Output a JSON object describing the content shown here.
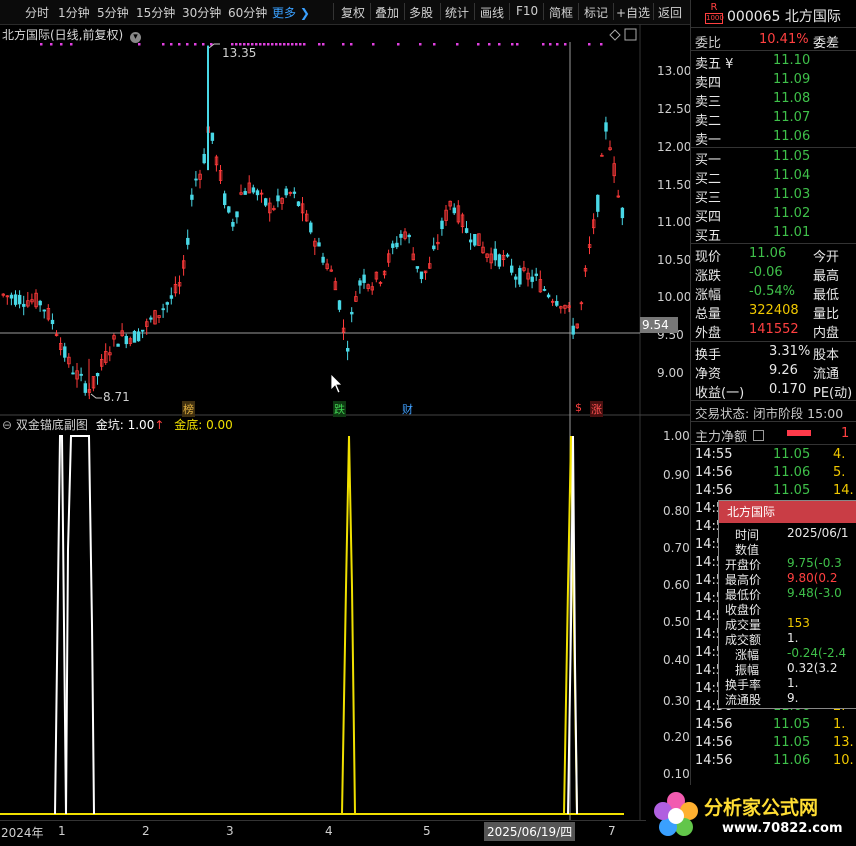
{
  "toolbar": {
    "items": [
      "分时",
      "1分钟",
      "5分钟",
      "15分钟",
      "30分钟",
      "60分钟",
      "更多 ❯",
      "复权",
      "叠加",
      "多股",
      "统计",
      "画线",
      "F10",
      "简框",
      "标记",
      "+自选",
      "返回"
    ]
  },
  "chart": {
    "title": "北方国际(日线,前复权)",
    "price_axis": [
      "13.00",
      "12.50",
      "12.00",
      "11.50",
      "11.00",
      "10.50",
      "10.00",
      "9.50",
      "9.00"
    ],
    "crosshair_price": "9.54",
    "high_label": "13.35",
    "low_label": "8.71",
    "markers": [
      "榜",
      "跌",
      "财",
      "$",
      "涨"
    ]
  },
  "indicator": {
    "name": "双金锚底副图",
    "jinkeng_label": "金坑:",
    "jinkeng_value": "1.00",
    "jindi_label": "金底:",
    "jindi_value": "0.00",
    "axis": [
      "1.00",
      "0.90",
      "0.80",
      "0.70",
      "0.60",
      "0.50",
      "0.40",
      "0.30",
      "0.20",
      "0.10"
    ]
  },
  "bottom_axis": {
    "labels": [
      "2024年",
      "1",
      "2",
      "3",
      "4",
      "5",
      "2025/06/19/四",
      "7"
    ]
  },
  "quote": {
    "code": "000065",
    "name": "北方国际",
    "badge_top": "R",
    "badge_bottom": "1000",
    "webi_label": "委比",
    "webi_value": "10.41%",
    "weicha_label": "委差",
    "asks": [
      {
        "label": "卖五 ¥",
        "price": "11.10"
      },
      {
        "label": "卖四",
        "price": "11.09"
      },
      {
        "label": "卖三",
        "price": "11.08"
      },
      {
        "label": "卖二",
        "price": "11.07"
      },
      {
        "label": "卖一",
        "price": "11.06"
      }
    ],
    "bids": [
      {
        "label": "买一",
        "price": "11.05"
      },
      {
        "label": "买二",
        "price": "11.04"
      },
      {
        "label": "买三",
        "price": "11.03"
      },
      {
        "label": "买四",
        "price": "11.02"
      },
      {
        "label": "买五",
        "price": "11.01"
      }
    ],
    "stats": [
      {
        "label": "现价",
        "value": "11.06",
        "label2": "今开"
      },
      {
        "label": "涨跌",
        "value": "-0.06",
        "label2": "最高"
      },
      {
        "label": "涨幅",
        "value": "-0.54%",
        "label2": "最低"
      },
      {
        "label": "总量",
        "value": "322408",
        "label2": "量比"
      },
      {
        "label": "外盘",
        "value": "141552",
        "label2": "内盘"
      }
    ],
    "stats2": [
      {
        "label": "换手",
        "value": "3.31%",
        "label2": "股本"
      },
      {
        "label": "净资",
        "value": "9.26",
        "label2": "流通"
      },
      {
        "label": "收益(一)",
        "value": "0.170",
        "label2": "PE(动)"
      }
    ],
    "status": "交易状态: 闭市阶段 15:00",
    "main_force_label": "主力净额",
    "main_force_value": "1"
  },
  "ticks": [
    {
      "time": "14:55",
      "price": "11.05",
      "vol": "4."
    },
    {
      "time": "14:56",
      "price": "11.06",
      "vol": "5."
    },
    {
      "time": "14:56",
      "price": "11.05",
      "vol": "14."
    },
    {
      "time": "14:5",
      "price": "",
      "vol": ""
    },
    {
      "time": "14:5",
      "price": "",
      "vol": ""
    },
    {
      "time": "14:5",
      "price": "",
      "vol": ""
    },
    {
      "time": "14:5",
      "price": "",
      "vol": ""
    },
    {
      "time": "14:5",
      "price": "",
      "vol": ""
    },
    {
      "time": "14:5",
      "price": "",
      "vol": ""
    },
    {
      "time": "14:5",
      "price": "",
      "vol": ""
    },
    {
      "time": "14:5",
      "price": "",
      "vol": ""
    },
    {
      "time": "14:5",
      "price": "",
      "vol": ""
    },
    {
      "time": "14:5",
      "price": "",
      "vol": ""
    },
    {
      "time": "14:5",
      "price": "",
      "vol": ""
    },
    {
      "time": "14:56",
      "price": "11.06",
      "vol": "2."
    },
    {
      "time": "14:56",
      "price": "11.05",
      "vol": "1."
    },
    {
      "time": "14:56",
      "price": "11.05",
      "vol": "13."
    },
    {
      "time": "14:56",
      "price": "11.06",
      "vol": "10."
    }
  ],
  "tooltip": {
    "title": "北方国际",
    "rows": [
      {
        "label": "时间",
        "value": "2025/06/1"
      },
      {
        "label": "数值",
        "value": ""
      },
      {
        "label": "开盘价",
        "value": "9.75(-0.3"
      },
      {
        "label": "最高价",
        "value": "9.80(0.2"
      },
      {
        "label": "最低价",
        "value": "9.48(-3.0"
      },
      {
        "label": "收盘价",
        "value": ""
      },
      {
        "label": "成交量",
        "value": "153"
      },
      {
        "label": "成交额",
        "value": "1."
      },
      {
        "label": "涨幅",
        "value": "-0.24(-2.4"
      },
      {
        "label": "振幅",
        "value": "0.32(3.2"
      },
      {
        "label": "换手率",
        "value": "1."
      },
      {
        "label": "流通股",
        "value": "9."
      }
    ]
  },
  "logo": {
    "text": "分析家公式网",
    "url": "www.70822.com"
  }
}
